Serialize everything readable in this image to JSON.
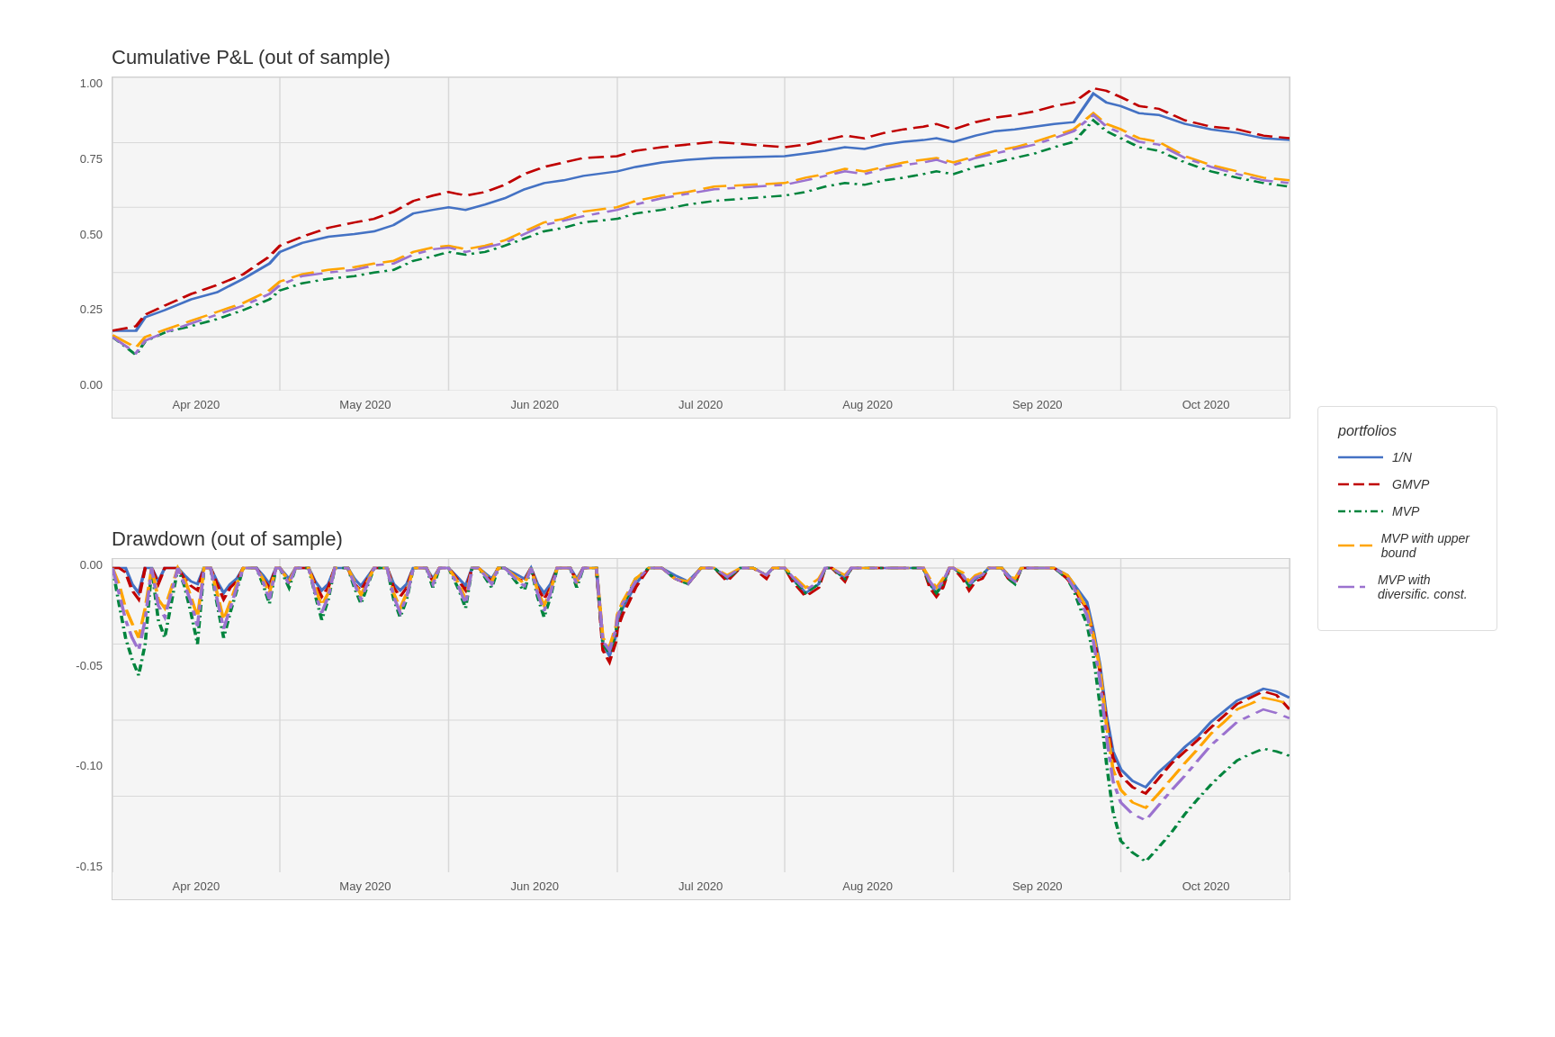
{
  "charts": {
    "top": {
      "title": "Cumulative P&L (out of sample)",
      "y_labels": [
        "1.00",
        "0.75",
        "0.50",
        "0.25",
        "0.00"
      ],
      "x_labels": [
        "Apr 2020",
        "May 2020",
        "Jun 2020",
        "Jul 2020",
        "Aug 2020",
        "Sep 2020",
        "Oct 2020"
      ]
    },
    "bottom": {
      "title": "Drawdown (out of sample)",
      "y_labels": [
        "0.00",
        "-0.05",
        "-0.10",
        "-0.15"
      ],
      "x_labels": [
        "Apr 2020",
        "May 2020",
        "Jun 2020",
        "Jul 2020",
        "Aug 2020",
        "Sep 2020",
        "Oct 2020"
      ]
    }
  },
  "legend": {
    "title": "portfolios",
    "items": [
      {
        "label": "1/N",
        "color": "#4472C4",
        "style": "solid"
      },
      {
        "label": "GMVP",
        "color": "#C00000",
        "style": "dashed"
      },
      {
        "label": "MVP",
        "color": "#00843D",
        "style": "dotdash"
      },
      {
        "label": "MVP with upper bound",
        "color": "#FFA500",
        "style": "longdash"
      },
      {
        "label": "MVP with diversific. const.",
        "color": "#9B72CF",
        "style": "longdash2"
      }
    ]
  }
}
